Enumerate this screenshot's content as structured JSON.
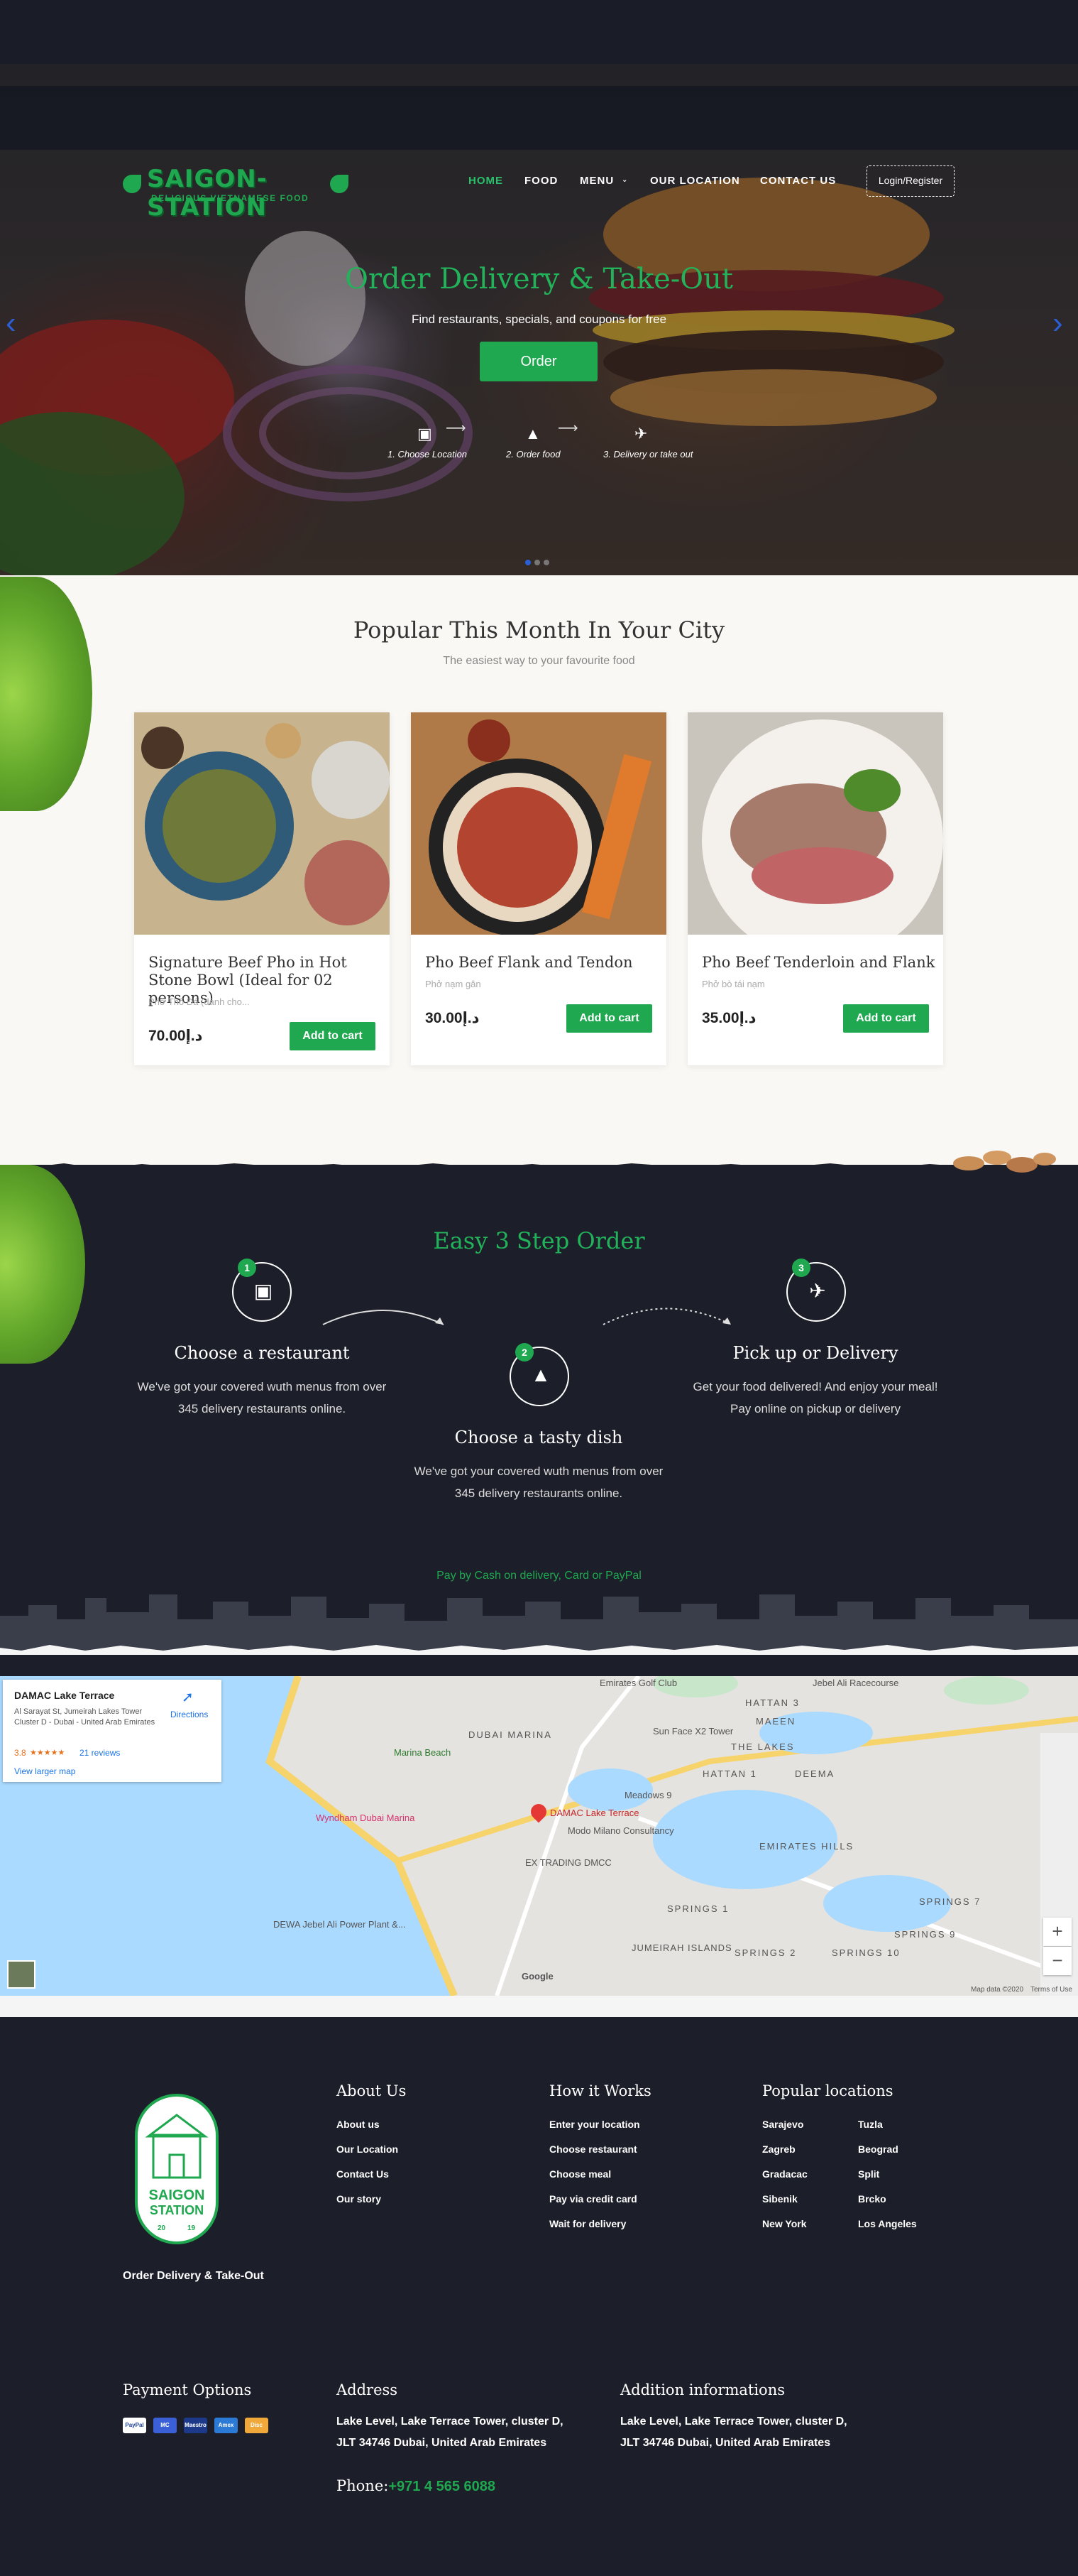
{
  "brand": {
    "name": "SAIGON-STATION",
    "tagline": "DELICIOUS VIETNAMESE FOOD"
  },
  "nav": {
    "items": [
      "HOME",
      "FOOD",
      "MENU",
      "OUR LOCATION",
      "CONTACT US"
    ],
    "login": "Login/Register"
  },
  "hero": {
    "title": "Order Delivery & Take-Out",
    "subtitle": "Find restaurants, specials, and coupons for free",
    "button": "Order",
    "steps": [
      "1. Choose Location",
      "2. Order food",
      "3. Delivery or take out"
    ]
  },
  "popular": {
    "title": "Popular This Month In Your City",
    "subtitle": "The easiest way to your favourite food",
    "items": [
      {
        "name": "Signature Beef Pho in Hot Stone Bowl (Ideal for 02 persons)",
        "alt": "Phở Thố Đá (dành cho...",
        "price": "70.00د.إ",
        "button": "Add to cart"
      },
      {
        "name": "Pho Beef Flank and Tendon",
        "alt": "Phở nạm gân",
        "price": "30.00د.إ",
        "button": "Add to cart"
      },
      {
        "name": "Pho Beef Tenderloin and Flank",
        "alt": "Phở bò tái nạm",
        "price": "35.00د.إ",
        "button": "Add to cart"
      }
    ]
  },
  "steps": {
    "title": "Easy 3 Step Order",
    "items": [
      {
        "num": "1",
        "title": "Choose a restaurant",
        "text": "We've got your covered wuth menus from over 345 delivery restaurants online."
      },
      {
        "num": "2",
        "title": "Choose a tasty dish",
        "text": "We've got your covered wuth menus from over 345 delivery restaurants online."
      },
      {
        "num": "3",
        "title": "Pick up or Delivery",
        "text": "Get your food delivered! And enjoy your meal! Pay online on pickup or delivery"
      }
    ],
    "pay_note": "Pay by Cash on delivery, Card or PayPal"
  },
  "map": {
    "place": "DAMAC Lake Terrace",
    "address": "Al Sarayat St, Jumeirah Lakes Tower Cluster D - Dubai - United Arab Emirates",
    "rating": "3.8",
    "stars": "★★★★★",
    "reviews": "21 reviews",
    "directions": "Directions",
    "larger": "View larger map",
    "labels": [
      "Emirates Golf Club",
      "Jebel Ali Racecourse",
      "DUBAI MARINA",
      "HATTAN 3",
      "MAEEN",
      "THE LAKES",
      "HATTAN 1",
      "DEEMA",
      "Marina Beach",
      "Sun Face X2 Tower",
      "Meadows 9",
      "Wyndham Dubai Marina",
      "DAMAC Lake Terrace",
      "Modo Milano Consultancy",
      "EX TRADING DMCC",
      "EMIRATES HILLS",
      "SPRINGS 1",
      "SPRINGS 9",
      "SPRINGS 7",
      "SPRINGS 2",
      "SPRINGS 10",
      "JUMEIRAH ISLANDS",
      "DEWA Jebel Ali Power Plant &...",
      "Google",
      "Map data ©2020",
      "Terms of Use"
    ],
    "zoom_in": "+",
    "zoom_out": "−"
  },
  "footer": {
    "tagline": "Order Delivery & Take-Out",
    "badge": {
      "line1": "SAIGON",
      "line2": "STATION",
      "est_left": "20",
      "est_right": "19"
    },
    "about": {
      "title": "About Us",
      "links": [
        "About us",
        "Our Location",
        "Contact Us",
        "Our story"
      ]
    },
    "how": {
      "title": "How it Works",
      "links": [
        "Enter your location",
        "Choose restaurant",
        "Choose meal",
        "Pay via credit card",
        "Wait for delivery"
      ]
    },
    "locations": {
      "title": "Popular locations",
      "col1": [
        "Sarajevo",
        "Zagreb",
        "Gradacac",
        "Sibenik",
        "New York"
      ],
      "col2": [
        "Tuzla",
        "Beograd",
        "Split",
        "Brcko",
        "Los Angeles"
      ]
    },
    "payment": {
      "title": "Payment Options",
      "cards": [
        "PayPal",
        "MC",
        "Maestro",
        "Amex",
        "Disc"
      ]
    },
    "address": {
      "title": "Address",
      "line1": "Lake Level, Lake Terrace Tower, cluster D,",
      "line2": "JLT 34746 Dubai, United Arab Emirates"
    },
    "additional": {
      "title": "Addition informations",
      "line1": "Lake Level, Lake Terrace Tower, cluster D,",
      "line2": "JLT 34746 Dubai, United Arab Emirates"
    },
    "phone_label": "Phone:",
    "phone": "+971 4 565 6088"
  },
  "colors": {
    "accent": "#1fa84f",
    "dark": "#1c1e29",
    "light": "#faf8f4"
  }
}
